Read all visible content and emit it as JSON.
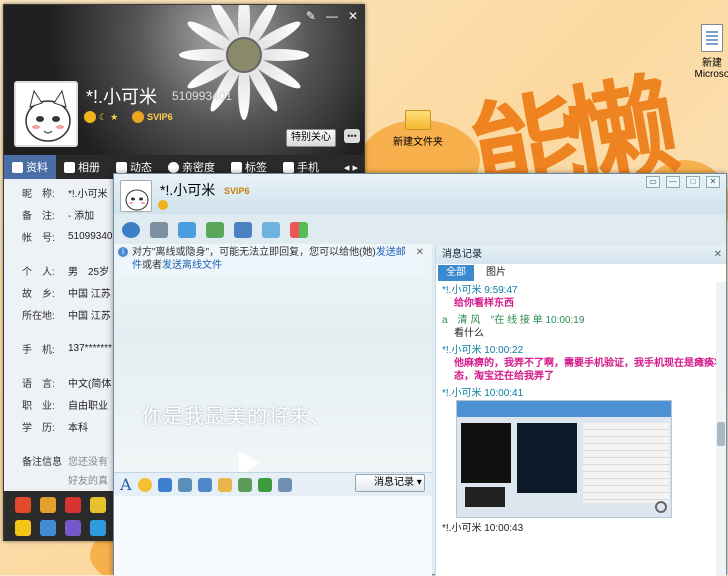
{
  "desktop": {
    "icon_new": "新建",
    "icon_microsoft": "Microso",
    "icon_folder": "新建文件夹",
    "bg_text": "能懒"
  },
  "profile": {
    "name": "*!.小可米",
    "qq": "510993401",
    "vip": "SVIP6",
    "special_care": "特别关心",
    "tabs": [
      "资料",
      "相册",
      "动态",
      "亲密度",
      "标签",
      "手机"
    ],
    "rows": [
      {
        "k": "昵　称:",
        "v": "*!.小可米"
      },
      {
        "k": "备　注:",
        "v": "- 添加"
      },
      {
        "k": "帐　号:",
        "v": "51099340"
      },
      {
        "k": "",
        "v": ""
      },
      {
        "k": "个　人:",
        "v": "男　25岁"
      },
      {
        "k": "故　乡:",
        "v": "中国 江苏"
      },
      {
        "k": "所在地:",
        "v": "中国 江苏"
      },
      {
        "k": "",
        "v": ""
      },
      {
        "k": "手　机:",
        "v": "137*******"
      },
      {
        "k": "",
        "v": ""
      },
      {
        "k": "语　言:",
        "v": "中文(简体"
      },
      {
        "k": "职　业:",
        "v": "自由职业"
      },
      {
        "k": "学　历:",
        "v": "本科"
      },
      {
        "k": "",
        "v": ""
      },
      {
        "k": "备注信息",
        "v": "您还没有"
      },
      {
        "k": "",
        "v": "好友的真"
      }
    ]
  },
  "chat": {
    "name": "*!.小可米",
    "vip": "SVIP6",
    "notice_prefix": "对方\"离线或隐身\"，可能无法立即回复，您可以给他(她)",
    "notice_link1": "发送邮件",
    "notice_mid": "或者",
    "notice_link2": "发送离线文件",
    "handwriting": "你是我最美的将来、",
    "history_button": "消息记录",
    "history": {
      "title": "消息记录",
      "tabs": [
        "全部",
        "图片"
      ],
      "messages": [
        {
          "header": "*!.小可米 9:59:47",
          "body": "给你看样东西",
          "pink": true,
          "who": "them"
        },
        {
          "header": "a　清 风　°在 线 接 单 10:00:19",
          "body": "看什么",
          "pink": false,
          "who": "me"
        },
        {
          "header": "*!.小可米 10:00:22",
          "body": "他麻痹的，我弄不了啊，需要手机验证，我手机现在是瘫痪状态，淘宝还在给我弄了",
          "pink": true,
          "who": "them"
        },
        {
          "header": "*!.小可米 10:00:41",
          "body": "",
          "pink": false,
          "who": "them"
        }
      ],
      "footer_header": "*!.小可米 10:00:43"
    }
  }
}
